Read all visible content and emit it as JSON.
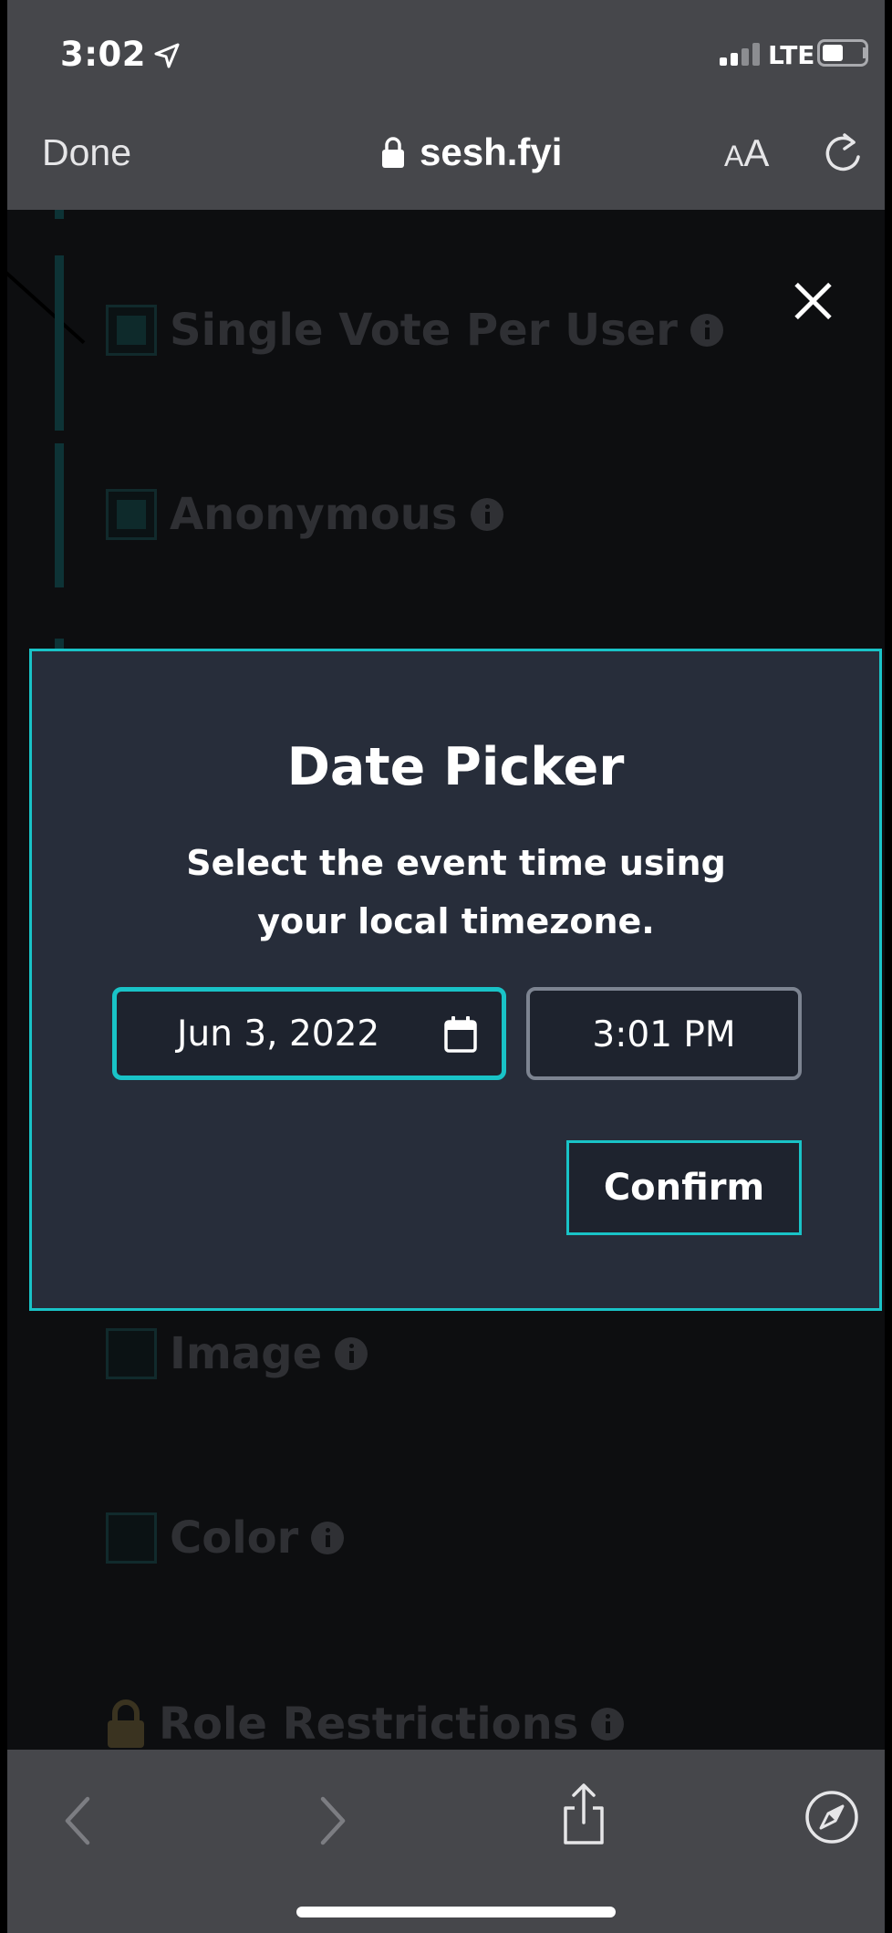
{
  "status_bar": {
    "time": "3:02",
    "network": "LTE"
  },
  "browser": {
    "done_label": "Done",
    "url": "sesh.fyi",
    "text_size_small": "A",
    "text_size_big": "A"
  },
  "background_options": [
    {
      "label": "Single Vote Per User",
      "checked": true
    },
    {
      "label": "Anonymous",
      "checked": true
    },
    {
      "label": "Image",
      "checked": false
    },
    {
      "label": "Color",
      "checked": false
    },
    {
      "label": "Role Restrictions",
      "locked": true
    }
  ],
  "modal": {
    "title": "Date Picker",
    "description": "Select the event time using your local timezone.",
    "date_value": "Jun 3, 2022",
    "time_value": "3:01 PM",
    "confirm_label": "Confirm"
  },
  "colors": {
    "accent": "#19c3c7",
    "modal_bg": "#272d3a",
    "chrome_bg": "#46474b"
  }
}
